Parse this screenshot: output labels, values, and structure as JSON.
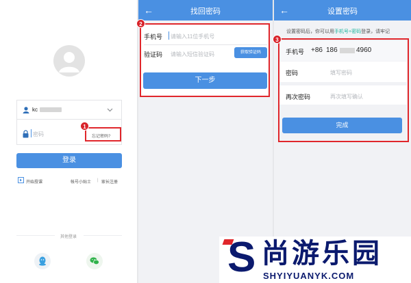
{
  "login": {
    "username_value": "kc",
    "password_placeholder": "密码",
    "forgot_label": "忘记密码?",
    "login_button": "登录",
    "start_class": "开始授课",
    "account_tips": "帐号小贴士",
    "parent_register": "家长注册",
    "separator": "|",
    "other_login": "其他登录"
  },
  "recover": {
    "title": "找回密码",
    "phone_label": "手机号",
    "phone_placeholder": "请输入11位手机号",
    "code_label": "验证码",
    "code_placeholder": "请输入短信验证码",
    "get_code_button": "获取验证码",
    "next_button": "下一步"
  },
  "setpwd": {
    "title": "设置密码",
    "hint_prefix": "设置密码后，你可以用",
    "hint_highlight": "手机号+密码",
    "hint_suffix": "登录，请牢记",
    "phone_label": "手机号",
    "phone_country": "+86",
    "phone_prefix": "186",
    "phone_suffix": "4960",
    "password_label": "密码",
    "password_placeholder": "填写密码",
    "confirm_label": "再次密码",
    "confirm_placeholder": "再次填写确认",
    "done_button": "完成"
  },
  "badges": [
    "1",
    "2",
    "3"
  ],
  "watermark": {
    "logo_letter": "S",
    "brand_cn": "尚游乐园",
    "brand_url": "SHYIYUANYK.COM"
  },
  "colors": {
    "accent": "#4a90e2",
    "annotation_red": "#e0262b",
    "highlight_teal": "#1fb59e"
  },
  "icons": [
    "back-arrow-icon",
    "user-icon",
    "lock-icon",
    "chevron-down-icon",
    "avatar-icon",
    "start-class-icon",
    "qq-icon",
    "wechat-icon"
  ]
}
